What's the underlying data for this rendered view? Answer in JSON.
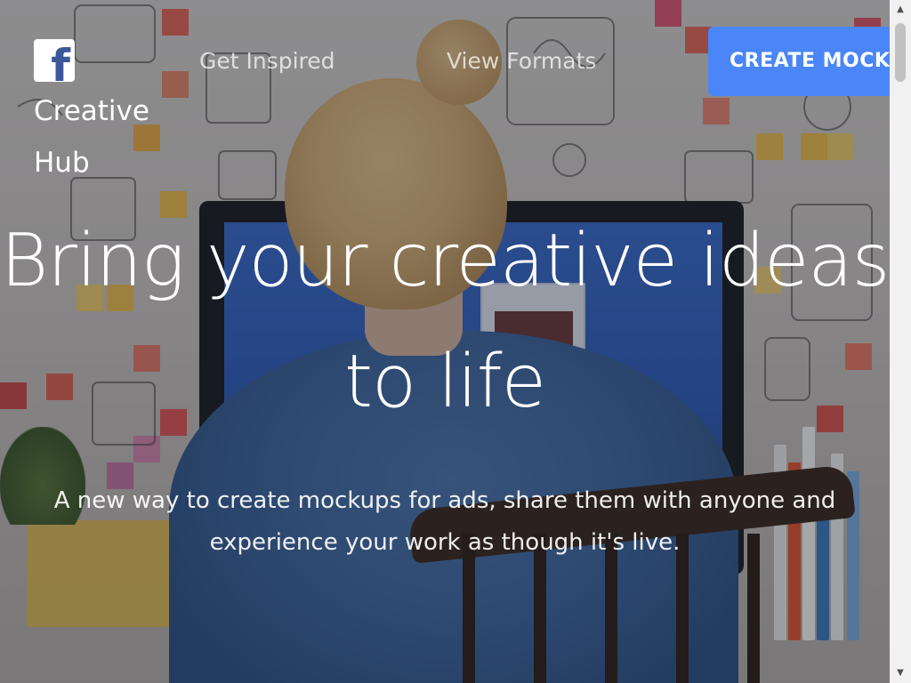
{
  "header": {
    "logo_icon": "facebook-f-icon",
    "logo_glyph": "f",
    "brand_text": "Creative Hub",
    "nav": [
      {
        "label": "Get Inspired"
      },
      {
        "label": "View Formats"
      }
    ],
    "cta_label": "CREATE MOCK"
  },
  "hero": {
    "headline": "Bring your creative ideas to life",
    "subhead": "A new way to create mockups for ads, share them with anyone and experience your work as though it's live."
  },
  "scrollbar": {
    "up_icon": "▲",
    "down_icon": "▼"
  },
  "colors": {
    "cta_background": "#4a86f7",
    "facebook_blue": "#3b5998",
    "text": "#ffffff"
  }
}
